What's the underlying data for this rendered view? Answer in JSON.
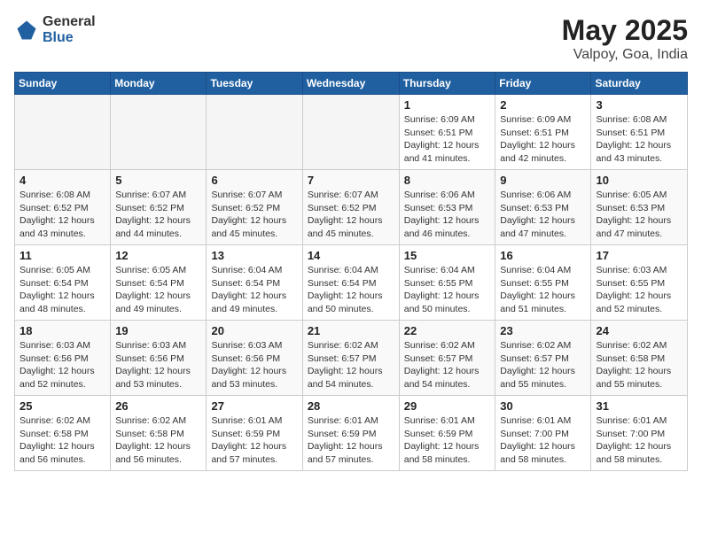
{
  "header": {
    "logo_general": "General",
    "logo_blue": "Blue",
    "month_year": "May 2025",
    "location": "Valpoy, Goa, India"
  },
  "days_of_week": [
    "Sunday",
    "Monday",
    "Tuesday",
    "Wednesday",
    "Thursday",
    "Friday",
    "Saturday"
  ],
  "weeks": [
    [
      {
        "day": "",
        "info": ""
      },
      {
        "day": "",
        "info": ""
      },
      {
        "day": "",
        "info": ""
      },
      {
        "day": "",
        "info": ""
      },
      {
        "day": "1",
        "info": "Sunrise: 6:09 AM\nSunset: 6:51 PM\nDaylight: 12 hours\nand 41 minutes."
      },
      {
        "day": "2",
        "info": "Sunrise: 6:09 AM\nSunset: 6:51 PM\nDaylight: 12 hours\nand 42 minutes."
      },
      {
        "day": "3",
        "info": "Sunrise: 6:08 AM\nSunset: 6:51 PM\nDaylight: 12 hours\nand 43 minutes."
      }
    ],
    [
      {
        "day": "4",
        "info": "Sunrise: 6:08 AM\nSunset: 6:52 PM\nDaylight: 12 hours\nand 43 minutes."
      },
      {
        "day": "5",
        "info": "Sunrise: 6:07 AM\nSunset: 6:52 PM\nDaylight: 12 hours\nand 44 minutes."
      },
      {
        "day": "6",
        "info": "Sunrise: 6:07 AM\nSunset: 6:52 PM\nDaylight: 12 hours\nand 45 minutes."
      },
      {
        "day": "7",
        "info": "Sunrise: 6:07 AM\nSunset: 6:52 PM\nDaylight: 12 hours\nand 45 minutes."
      },
      {
        "day": "8",
        "info": "Sunrise: 6:06 AM\nSunset: 6:53 PM\nDaylight: 12 hours\nand 46 minutes."
      },
      {
        "day": "9",
        "info": "Sunrise: 6:06 AM\nSunset: 6:53 PM\nDaylight: 12 hours\nand 47 minutes."
      },
      {
        "day": "10",
        "info": "Sunrise: 6:05 AM\nSunset: 6:53 PM\nDaylight: 12 hours\nand 47 minutes."
      }
    ],
    [
      {
        "day": "11",
        "info": "Sunrise: 6:05 AM\nSunset: 6:54 PM\nDaylight: 12 hours\nand 48 minutes."
      },
      {
        "day": "12",
        "info": "Sunrise: 6:05 AM\nSunset: 6:54 PM\nDaylight: 12 hours\nand 49 minutes."
      },
      {
        "day": "13",
        "info": "Sunrise: 6:04 AM\nSunset: 6:54 PM\nDaylight: 12 hours\nand 49 minutes."
      },
      {
        "day": "14",
        "info": "Sunrise: 6:04 AM\nSunset: 6:54 PM\nDaylight: 12 hours\nand 50 minutes."
      },
      {
        "day": "15",
        "info": "Sunrise: 6:04 AM\nSunset: 6:55 PM\nDaylight: 12 hours\nand 50 minutes."
      },
      {
        "day": "16",
        "info": "Sunrise: 6:04 AM\nSunset: 6:55 PM\nDaylight: 12 hours\nand 51 minutes."
      },
      {
        "day": "17",
        "info": "Sunrise: 6:03 AM\nSunset: 6:55 PM\nDaylight: 12 hours\nand 52 minutes."
      }
    ],
    [
      {
        "day": "18",
        "info": "Sunrise: 6:03 AM\nSunset: 6:56 PM\nDaylight: 12 hours\nand 52 minutes."
      },
      {
        "day": "19",
        "info": "Sunrise: 6:03 AM\nSunset: 6:56 PM\nDaylight: 12 hours\nand 53 minutes."
      },
      {
        "day": "20",
        "info": "Sunrise: 6:03 AM\nSunset: 6:56 PM\nDaylight: 12 hours\nand 53 minutes."
      },
      {
        "day": "21",
        "info": "Sunrise: 6:02 AM\nSunset: 6:57 PM\nDaylight: 12 hours\nand 54 minutes."
      },
      {
        "day": "22",
        "info": "Sunrise: 6:02 AM\nSunset: 6:57 PM\nDaylight: 12 hours\nand 54 minutes."
      },
      {
        "day": "23",
        "info": "Sunrise: 6:02 AM\nSunset: 6:57 PM\nDaylight: 12 hours\nand 55 minutes."
      },
      {
        "day": "24",
        "info": "Sunrise: 6:02 AM\nSunset: 6:58 PM\nDaylight: 12 hours\nand 55 minutes."
      }
    ],
    [
      {
        "day": "25",
        "info": "Sunrise: 6:02 AM\nSunset: 6:58 PM\nDaylight: 12 hours\nand 56 minutes."
      },
      {
        "day": "26",
        "info": "Sunrise: 6:02 AM\nSunset: 6:58 PM\nDaylight: 12 hours\nand 56 minutes."
      },
      {
        "day": "27",
        "info": "Sunrise: 6:01 AM\nSunset: 6:59 PM\nDaylight: 12 hours\nand 57 minutes."
      },
      {
        "day": "28",
        "info": "Sunrise: 6:01 AM\nSunset: 6:59 PM\nDaylight: 12 hours\nand 57 minutes."
      },
      {
        "day": "29",
        "info": "Sunrise: 6:01 AM\nSunset: 6:59 PM\nDaylight: 12 hours\nand 58 minutes."
      },
      {
        "day": "30",
        "info": "Sunrise: 6:01 AM\nSunset: 7:00 PM\nDaylight: 12 hours\nand 58 minutes."
      },
      {
        "day": "31",
        "info": "Sunrise: 6:01 AM\nSunset: 7:00 PM\nDaylight: 12 hours\nand 58 minutes."
      }
    ]
  ]
}
